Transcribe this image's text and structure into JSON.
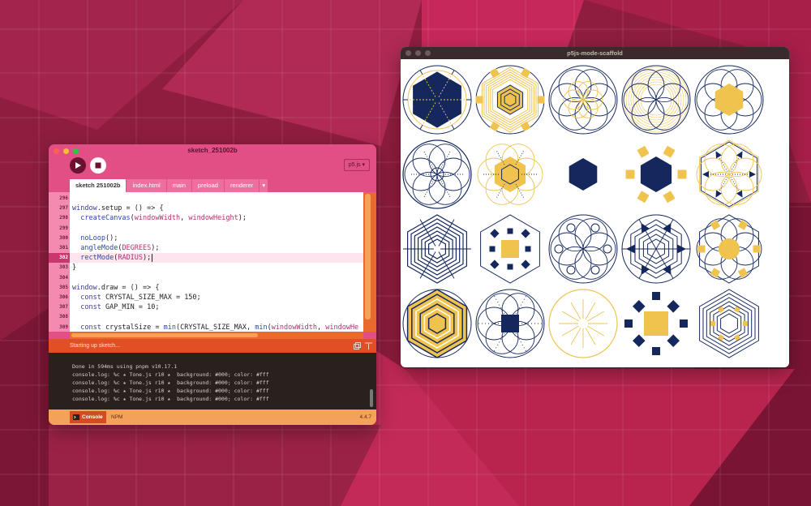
{
  "colors": {
    "navy": "#15285e",
    "gold": "#f0c34f",
    "pink": "#e24f85",
    "orange": "#e05024",
    "console_bg": "#2a201e"
  },
  "editor": {
    "title": "sketch_251002b",
    "version": "p5.js ▾",
    "tabs": [
      "sketch 251002b",
      "index.html",
      "main",
      "preload",
      "renderer",
      "▾"
    ],
    "lines": [
      {
        "n": "296",
        "code": ""
      },
      {
        "n": "297",
        "code": "window.setup = () => {"
      },
      {
        "n": "298",
        "code": "  createCanvas(windowWidth, windowHeight);"
      },
      {
        "n": "299",
        "code": ""
      },
      {
        "n": "300",
        "code": "  noLoop();"
      },
      {
        "n": "301",
        "code": "  angleMode(DEGREES);"
      },
      {
        "n": "302",
        "code": "  rectMode(RADIUS);"
      },
      {
        "n": "303",
        "code": "}"
      },
      {
        "n": "304",
        "code": ""
      },
      {
        "n": "305",
        "code": "window.draw = () => {"
      },
      {
        "n": "306",
        "code": "  const CRYSTAL_SIZE_MAX = 150;"
      },
      {
        "n": "307",
        "code": "  const GAP_MIN = 10;"
      },
      {
        "n": "308",
        "code": ""
      },
      {
        "n": "309",
        "code": "  const crystalSize = min(CRYSTAL_SIZE_MAX, min(windowWidth, windowHe"
      }
    ],
    "status": "Starting up sketch...",
    "console": [
      "Done in 594ms using pnpm v10.17.1",
      "console.log: %c ★ Tone.js r10 ★  background: #000; color: #fff",
      "console.log: %c ★ Tone.js r10 ★  background: #000; color: #fff",
      "console.log: %c ★ Tone.js r10 ★  background: #000; color: #fff",
      "console.log: %c ★ Tone.js r10 ★  background: #000; color: #fff"
    ],
    "console_tab": "Console",
    "npm_tab": "NPM",
    "app_version": "4.4.7"
  },
  "preview": {
    "title": "p5js-mode-scaffold",
    "crystals": [
      [
        "hexagon-navy-ring",
        "circle-lattice-gold",
        "petal-navy-gold",
        "petal-gold-dense",
        "hexagon-gold-petal"
      ],
      [
        "petal-navy",
        "hexagon-gold-lattice",
        "hexagon-navy-solid",
        "hexagon-navy-squares",
        "lattice-gold-triangles"
      ],
      [
        "concentric-hexagon-navy",
        "hexagon-squares-mixed",
        "petal-navy-small",
        "lattice-navy-triangles",
        "petal-gold-squares"
      ],
      [
        "concentric-hexagon-gold",
        "petal-navy-square",
        "sunburst-gold",
        "square-gold-navy",
        "concentric-hexagon-outline"
      ]
    ]
  }
}
